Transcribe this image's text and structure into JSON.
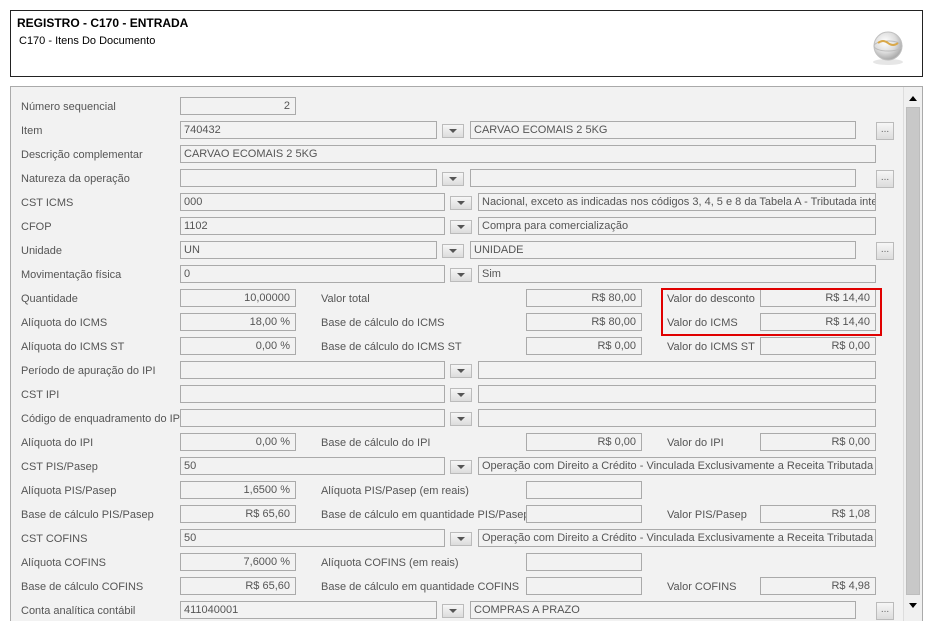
{
  "header": {
    "title": "REGISTRO - C170 - ENTRADA",
    "subtitle": "C170 - Itens Do Documento"
  },
  "fields": {
    "numero_sequencial": {
      "label": "Número sequencial",
      "value": "2"
    },
    "item": {
      "label": "Item",
      "code": "740432",
      "desc": "CARVAO ECOMAIS 2 5KG"
    },
    "descricao_complementar": {
      "label": "Descrição complementar",
      "value": "CARVAO ECOMAIS 2 5KG"
    },
    "natureza_operacao": {
      "label": "Natureza da operação",
      "code": "",
      "desc": ""
    },
    "cst_icms": {
      "label": "CST ICMS",
      "code": "000",
      "desc": "Nacional, exceto as indicadas nos códigos 3, 4, 5 e 8 da Tabela A - Tributada inte"
    },
    "cfop": {
      "label": "CFOP",
      "code": "1102",
      "desc": "Compra para comercialização"
    },
    "unidade": {
      "label": "Unidade",
      "code": "UN",
      "desc": "UNIDADE"
    },
    "movimentacao_fisica": {
      "label": "Movimentação física",
      "code": "0",
      "desc": "Sim"
    },
    "quantidade": {
      "label": "Quantidade",
      "value": "10,00000"
    },
    "valor_total": {
      "label": "Valor total",
      "value": "R$ 80,00"
    },
    "valor_desconto": {
      "label": "Valor do desconto",
      "value": "R$ 14,40"
    },
    "aliquota_icms": {
      "label": "Alíquota do ICMS",
      "value": "18,00 %"
    },
    "base_calculo_icms": {
      "label": "Base de cálculo do ICMS",
      "value": "R$ 80,00"
    },
    "valor_icms": {
      "label": "Valor do ICMS",
      "value": "R$ 14,40"
    },
    "aliquota_icms_st": {
      "label": "Alíquota do ICMS ST",
      "value": "0,00 %"
    },
    "base_calculo_icms_st": {
      "label": "Base de cálculo do ICMS ST",
      "value": "R$ 0,00"
    },
    "valor_icms_st": {
      "label": "Valor do ICMS ST",
      "value": "R$ 0,00"
    },
    "periodo_apuracao_ipi": {
      "label": "Período de apuração do IPI",
      "code": "",
      "desc": ""
    },
    "cst_ipi": {
      "label": "CST IPI",
      "code": "",
      "desc": ""
    },
    "codigo_enquadramento_ipi": {
      "label": "Código de enquadramento do IPI",
      "code": "",
      "desc": ""
    },
    "aliquota_ipi": {
      "label": "Alíquota do IPI",
      "value": "0,00 %"
    },
    "base_calculo_ipi": {
      "label": "Base de cálculo do IPI",
      "value": "R$ 0,00"
    },
    "valor_ipi": {
      "label": "Valor do IPI",
      "value": "R$ 0,00"
    },
    "cst_pis": {
      "label": "CST PIS/Pasep",
      "code": "50",
      "desc": "Operação com Direito a Crédito - Vinculada Exclusivamente a Receita Tributada n"
    },
    "aliquota_pis": {
      "label": "Alíquota PIS/Pasep",
      "value": "1,6500 %"
    },
    "aliquota_pis_reais": {
      "label": "Alíquota PIS/Pasep (em reais)",
      "value": ""
    },
    "base_calculo_pis": {
      "label": "Base de cálculo PIS/Pasep",
      "value": "R$ 65,60"
    },
    "base_calculo_qtd_pis": {
      "label": "Base de cálculo em quantidade PIS/Pasep",
      "value": ""
    },
    "valor_pis": {
      "label": "Valor PIS/Pasep",
      "value": "R$ 1,08"
    },
    "cst_cofins": {
      "label": "CST COFINS",
      "code": "50",
      "desc": "Operação com Direito a Crédito - Vinculada Exclusivamente a Receita Tributada n"
    },
    "aliquota_cofins": {
      "label": "Alíquota COFINS",
      "value": "7,6000 %"
    },
    "aliquota_cofins_reais": {
      "label": "Alíquota COFINS (em reais)",
      "value": ""
    },
    "base_calculo_cofins": {
      "label": "Base de cálculo COFINS",
      "value": "R$ 65,60"
    },
    "base_calculo_qtd_cofins": {
      "label": "Base de cálculo em quantidade COFINS",
      "value": ""
    },
    "valor_cofins": {
      "label": "Valor COFINS",
      "value": "R$ 4,98"
    },
    "conta_analitica": {
      "label": "Conta analítica contábil",
      "code": "411040001",
      "desc": "COMPRAS A PRAZO"
    }
  },
  "buttons": {
    "ellipsis": "..."
  },
  "colors": {
    "highlight": "#e00000",
    "field_border": "#aaaaaa",
    "panel_bg": "#f2f2f2"
  },
  "icons": {
    "logo": "globe-logo-icon",
    "dropdown": "chevron-down-icon",
    "scroll_up": "arrow-up-icon",
    "scroll_down": "arrow-down-icon"
  }
}
